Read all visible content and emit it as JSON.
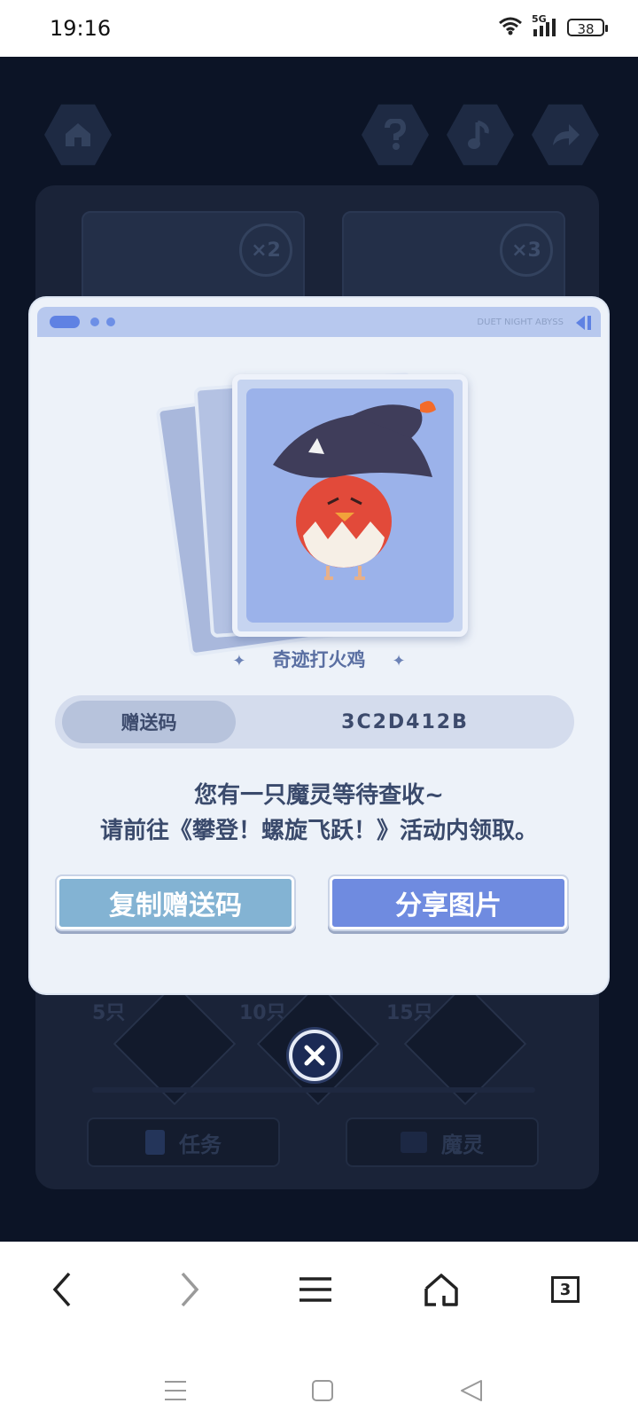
{
  "status_bar": {
    "time": "19:16",
    "network": "5G",
    "battery": "38"
  },
  "background": {
    "milestones": [
      "5只",
      "10只",
      "15只"
    ],
    "card_counts": [
      "×2",
      "×3"
    ],
    "tabs": [
      "任务",
      "魔灵"
    ]
  },
  "dialog": {
    "header_brand": "DUET NIGHT ABYSS",
    "pet_name": "奇迹打火鸡",
    "gift_code_label": "赠送码",
    "gift_code_value": "3C2D412B",
    "message_line1": "您有一只魔灵等待查收~",
    "message_line2": "请前往《攀登！螺旋飞跃！》活动内领取。",
    "copy_button": "复制赠送码",
    "share_button": "分享图片"
  },
  "browser_nav": {
    "tab_count": "3"
  },
  "colors": {
    "dialog_bg": "#edf2f9",
    "copy_button": "#83b3d3",
    "share_button": "#6f8be0",
    "game_bg": "#0c1426"
  }
}
